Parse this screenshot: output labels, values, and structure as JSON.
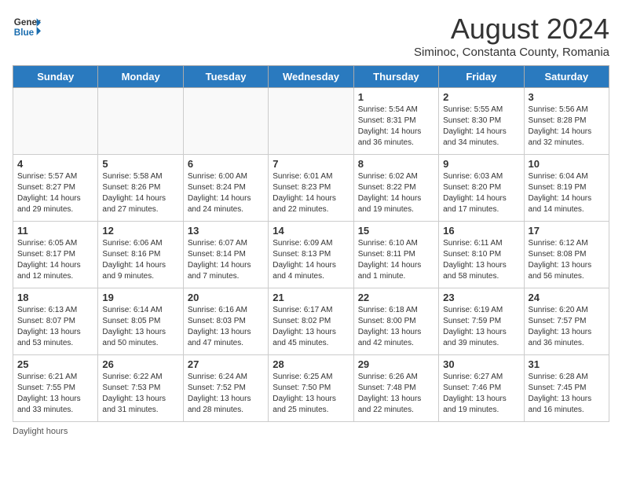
{
  "header": {
    "logo_general": "General",
    "logo_blue": "Blue",
    "month_title": "August 2024",
    "location": "Siminoc, Constanta County, Romania"
  },
  "weekdays": [
    "Sunday",
    "Monday",
    "Tuesday",
    "Wednesday",
    "Thursday",
    "Friday",
    "Saturday"
  ],
  "weeks": [
    [
      {
        "day": "",
        "info": ""
      },
      {
        "day": "",
        "info": ""
      },
      {
        "day": "",
        "info": ""
      },
      {
        "day": "",
        "info": ""
      },
      {
        "day": "1",
        "info": "Sunrise: 5:54 AM\nSunset: 8:31 PM\nDaylight: 14 hours\nand 36 minutes."
      },
      {
        "day": "2",
        "info": "Sunrise: 5:55 AM\nSunset: 8:30 PM\nDaylight: 14 hours\nand 34 minutes."
      },
      {
        "day": "3",
        "info": "Sunrise: 5:56 AM\nSunset: 8:28 PM\nDaylight: 14 hours\nand 32 minutes."
      }
    ],
    [
      {
        "day": "4",
        "info": "Sunrise: 5:57 AM\nSunset: 8:27 PM\nDaylight: 14 hours\nand 29 minutes."
      },
      {
        "day": "5",
        "info": "Sunrise: 5:58 AM\nSunset: 8:26 PM\nDaylight: 14 hours\nand 27 minutes."
      },
      {
        "day": "6",
        "info": "Sunrise: 6:00 AM\nSunset: 8:24 PM\nDaylight: 14 hours\nand 24 minutes."
      },
      {
        "day": "7",
        "info": "Sunrise: 6:01 AM\nSunset: 8:23 PM\nDaylight: 14 hours\nand 22 minutes."
      },
      {
        "day": "8",
        "info": "Sunrise: 6:02 AM\nSunset: 8:22 PM\nDaylight: 14 hours\nand 19 minutes."
      },
      {
        "day": "9",
        "info": "Sunrise: 6:03 AM\nSunset: 8:20 PM\nDaylight: 14 hours\nand 17 minutes."
      },
      {
        "day": "10",
        "info": "Sunrise: 6:04 AM\nSunset: 8:19 PM\nDaylight: 14 hours\nand 14 minutes."
      }
    ],
    [
      {
        "day": "11",
        "info": "Sunrise: 6:05 AM\nSunset: 8:17 PM\nDaylight: 14 hours\nand 12 minutes."
      },
      {
        "day": "12",
        "info": "Sunrise: 6:06 AM\nSunset: 8:16 PM\nDaylight: 14 hours\nand 9 minutes."
      },
      {
        "day": "13",
        "info": "Sunrise: 6:07 AM\nSunset: 8:14 PM\nDaylight: 14 hours\nand 7 minutes."
      },
      {
        "day": "14",
        "info": "Sunrise: 6:09 AM\nSunset: 8:13 PM\nDaylight: 14 hours\nand 4 minutes."
      },
      {
        "day": "15",
        "info": "Sunrise: 6:10 AM\nSunset: 8:11 PM\nDaylight: 14 hours\nand 1 minute."
      },
      {
        "day": "16",
        "info": "Sunrise: 6:11 AM\nSunset: 8:10 PM\nDaylight: 13 hours\nand 58 minutes."
      },
      {
        "day": "17",
        "info": "Sunrise: 6:12 AM\nSunset: 8:08 PM\nDaylight: 13 hours\nand 56 minutes."
      }
    ],
    [
      {
        "day": "18",
        "info": "Sunrise: 6:13 AM\nSunset: 8:07 PM\nDaylight: 13 hours\nand 53 minutes."
      },
      {
        "day": "19",
        "info": "Sunrise: 6:14 AM\nSunset: 8:05 PM\nDaylight: 13 hours\nand 50 minutes."
      },
      {
        "day": "20",
        "info": "Sunrise: 6:16 AM\nSunset: 8:03 PM\nDaylight: 13 hours\nand 47 minutes."
      },
      {
        "day": "21",
        "info": "Sunrise: 6:17 AM\nSunset: 8:02 PM\nDaylight: 13 hours\nand 45 minutes."
      },
      {
        "day": "22",
        "info": "Sunrise: 6:18 AM\nSunset: 8:00 PM\nDaylight: 13 hours\nand 42 minutes."
      },
      {
        "day": "23",
        "info": "Sunrise: 6:19 AM\nSunset: 7:59 PM\nDaylight: 13 hours\nand 39 minutes."
      },
      {
        "day": "24",
        "info": "Sunrise: 6:20 AM\nSunset: 7:57 PM\nDaylight: 13 hours\nand 36 minutes."
      }
    ],
    [
      {
        "day": "25",
        "info": "Sunrise: 6:21 AM\nSunset: 7:55 PM\nDaylight: 13 hours\nand 33 minutes."
      },
      {
        "day": "26",
        "info": "Sunrise: 6:22 AM\nSunset: 7:53 PM\nDaylight: 13 hours\nand 31 minutes."
      },
      {
        "day": "27",
        "info": "Sunrise: 6:24 AM\nSunset: 7:52 PM\nDaylight: 13 hours\nand 28 minutes."
      },
      {
        "day": "28",
        "info": "Sunrise: 6:25 AM\nSunset: 7:50 PM\nDaylight: 13 hours\nand 25 minutes."
      },
      {
        "day": "29",
        "info": "Sunrise: 6:26 AM\nSunset: 7:48 PM\nDaylight: 13 hours\nand 22 minutes."
      },
      {
        "day": "30",
        "info": "Sunrise: 6:27 AM\nSunset: 7:46 PM\nDaylight: 13 hours\nand 19 minutes."
      },
      {
        "day": "31",
        "info": "Sunrise: 6:28 AM\nSunset: 7:45 PM\nDaylight: 13 hours\nand 16 minutes."
      }
    ]
  ],
  "footer": {
    "daylight_label": "Daylight hours"
  }
}
